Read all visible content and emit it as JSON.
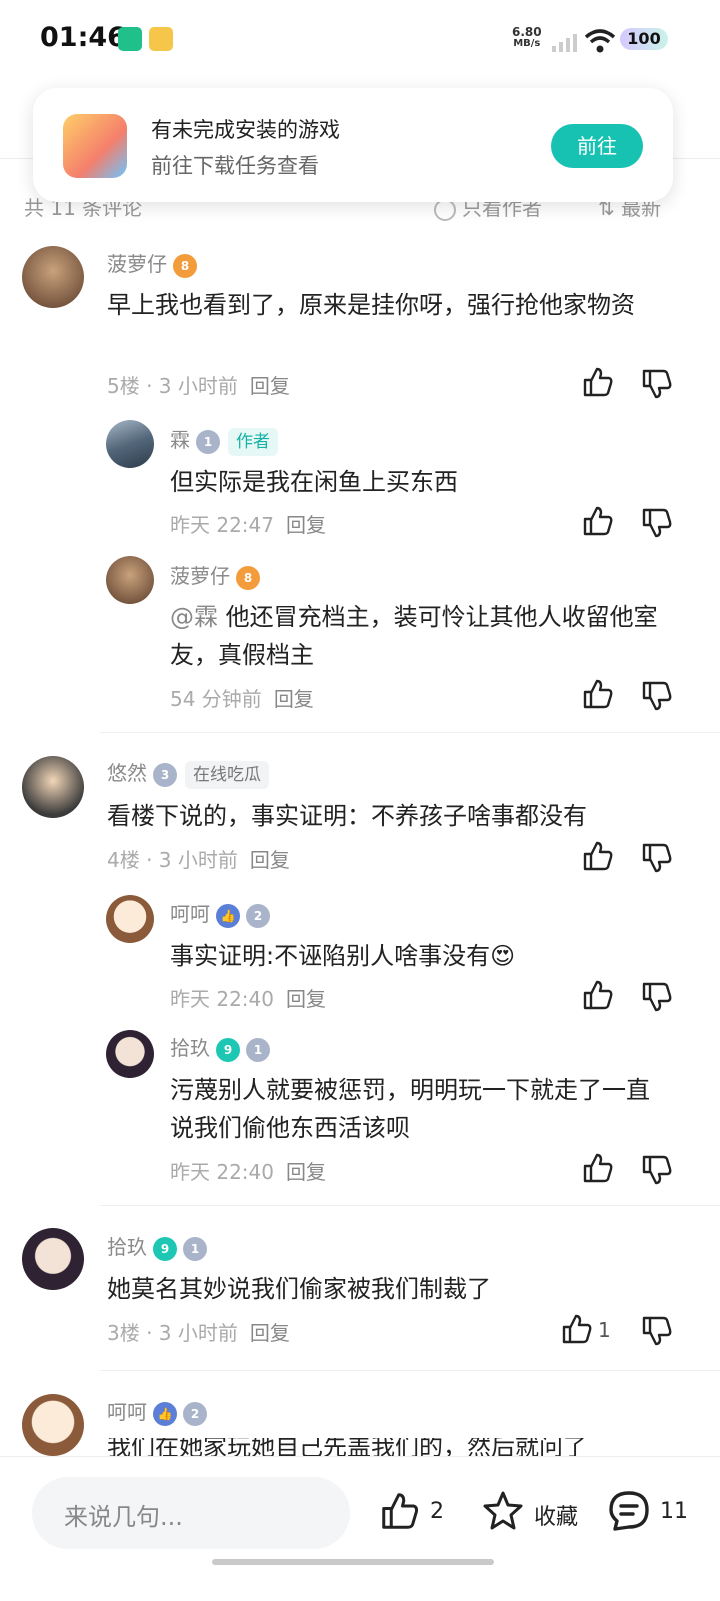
{
  "status": {
    "time": "01:46",
    "speed_value": "6.80",
    "speed_unit": "MB/s",
    "battery": "100"
  },
  "toast": {
    "title": "有未完成安装的游戏",
    "subtitle": "前往下载任务查看",
    "button": "前往"
  },
  "header": {
    "comment_total": "共 11 条评论",
    "only_author": "只看作者",
    "sort": "最新"
  },
  "comments": [
    {
      "user": "菠萝仔",
      "level": "8",
      "text": "早上我也看到了，原来是挂你呀，强行抢他家物资",
      "floor": "5楼 · 3 小时前",
      "reply": "回复",
      "replies": [
        {
          "user": "霖",
          "level": "1",
          "tag": "作者",
          "text": "但实际是我在闲鱼上买东西",
          "time": "昨天 22:47",
          "reply": "回复"
        },
        {
          "user": "菠萝仔",
          "level": "8",
          "mention": "@霖",
          "text": " 他还冒充档主，装可怜让其他人收留他室友，真假档主",
          "time": "54 分钟前",
          "reply": "回复"
        }
      ]
    },
    {
      "user": "悠然",
      "level": "3",
      "tag": "在线吃瓜",
      "text": "看楼下说的，事实证明：不养孩子啥事都没有",
      "floor": "4楼 · 3 小时前",
      "reply": "回复",
      "replies": [
        {
          "user": "呵呵",
          "level": "2",
          "text": "事实证明:不诬陷别人啥事没有😍",
          "time": "昨天 22:40",
          "reply": "回复"
        },
        {
          "user": "拾玖",
          "level": "1",
          "badge": "9",
          "text": "污蔑别人就要被惩罚，明明玩一下就走了一直说我们偷他东西活该呗",
          "time": "昨天 22:40",
          "reply": "回复"
        }
      ]
    },
    {
      "user": "拾玖",
      "level": "1",
      "badge": "9",
      "text": "她莫名其妙说我们偷家被我们制裁了",
      "floor": "3楼 · 3 小时前",
      "reply": "回复",
      "likes": "1"
    },
    {
      "user": "呵呵",
      "level": "2",
      "text": "我们在她家玩她自己先盖我们的，然后就问了"
    }
  ],
  "bottom": {
    "placeholder": "来说几句...",
    "like_count": "2",
    "favorite": "收藏",
    "comment_count": "11"
  },
  "colors": {
    "accent": "#17c2b3",
    "meta_gray": "#aaaaaa"
  }
}
